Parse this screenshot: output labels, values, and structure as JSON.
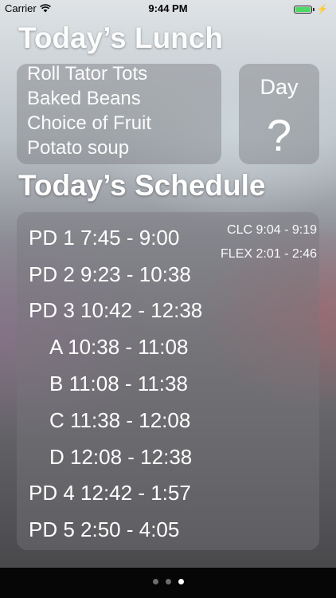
{
  "status_bar": {
    "carrier": "Carrier",
    "time": "9:44 PM"
  },
  "lunch": {
    "title": "Today’s Lunch",
    "items": [
      "Roll Tator Tots",
      "Baked Beans",
      "Choice of Fruit",
      "Potato soup"
    ]
  },
  "day": {
    "label": "Day",
    "value": "?"
  },
  "schedule": {
    "title": "Today’s Schedule",
    "periods": [
      "PD 1  7:45 - 9:00",
      "PD 2 9:23 - 10:38",
      "PD 3 10:42 - 12:38",
      "A 10:38 - 11:08",
      "B 11:08 - 11:38",
      "C 11:38 - 12:08",
      "D 12:08 - 12:38",
      "PD 4 12:42 - 1:57",
      "PD 5 2:50 - 4:05"
    ],
    "clc": "CLC 9:04 - 9:19",
    "flex": "FLEX 2:01 - 2:46"
  },
  "page_control": {
    "pages": 3,
    "current": 3
  },
  "colors": {
    "battery": "#4cd964",
    "bottom_bar": "#060606"
  }
}
